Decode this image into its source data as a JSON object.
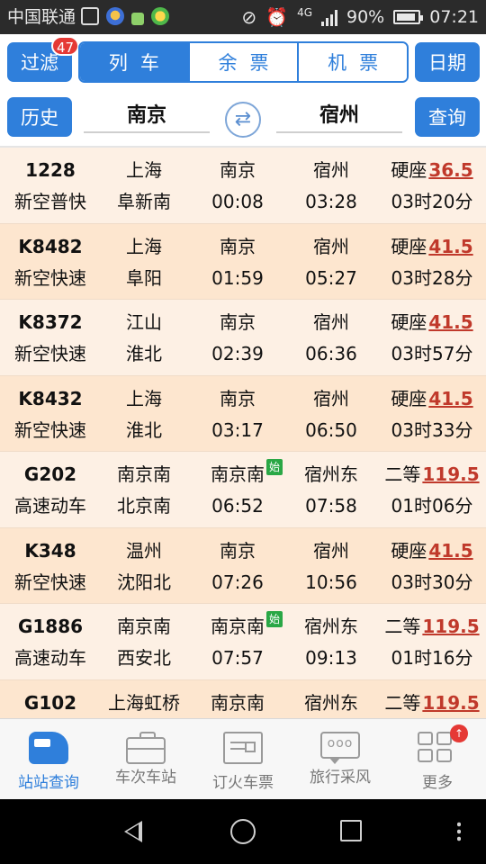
{
  "status_bar": {
    "carrier": "中国联通",
    "network": "4G",
    "battery_text": "90%",
    "battery_level": 0.9,
    "time": "07:21"
  },
  "top_bar": {
    "filter_label": "过滤",
    "filter_badge": "47",
    "segments": [
      {
        "label": "列车",
        "active": true
      },
      {
        "label": "余票",
        "active": false
      },
      {
        "label": "机票",
        "active": false
      }
    ],
    "date_label": "日期"
  },
  "search": {
    "history_label": "历史",
    "from_station": "南京",
    "to_station": "宿州",
    "swap_icon": "swap-arrows-icon",
    "query_label": "查询"
  },
  "trains": [
    {
      "no": "1228",
      "type": "新空普快",
      "origin": "上海",
      "terminal": "阜新南",
      "from": "南京",
      "depart": "00:08",
      "to": "宿州",
      "arrive": "03:28",
      "seat": "硬座",
      "price": "36.5",
      "duration": "03时20分",
      "origin_tag": ""
    },
    {
      "no": "K8482",
      "type": "新空快速",
      "origin": "上海",
      "terminal": "阜阳",
      "from": "南京",
      "depart": "01:59",
      "to": "宿州",
      "arrive": "05:27",
      "seat": "硬座",
      "price": "41.5",
      "duration": "03时28分",
      "origin_tag": ""
    },
    {
      "no": "K8372",
      "type": "新空快速",
      "origin": "江山",
      "terminal": "淮北",
      "from": "南京",
      "depart": "02:39",
      "to": "宿州",
      "arrive": "06:36",
      "seat": "硬座",
      "price": "41.5",
      "duration": "03时57分",
      "origin_tag": ""
    },
    {
      "no": "K8432",
      "type": "新空快速",
      "origin": "上海",
      "terminal": "淮北",
      "from": "南京",
      "depart": "03:17",
      "to": "宿州",
      "arrive": "06:50",
      "seat": "硬座",
      "price": "41.5",
      "duration": "03时33分",
      "origin_tag": ""
    },
    {
      "no": "G202",
      "type": "高速动车",
      "origin": "南京南",
      "terminal": "北京南",
      "from": "南京南",
      "depart": "06:52",
      "to": "宿州东",
      "arrive": "07:58",
      "seat": "二等",
      "price": "119.5",
      "duration": "01时06分",
      "origin_tag": "始"
    },
    {
      "no": "K348",
      "type": "新空快速",
      "origin": "温州",
      "terminal": "沈阳北",
      "from": "南京",
      "depart": "07:26",
      "to": "宿州",
      "arrive": "10:56",
      "seat": "硬座",
      "price": "41.5",
      "duration": "03时30分",
      "origin_tag": ""
    },
    {
      "no": "G1886",
      "type": "高速动车",
      "origin": "南京南",
      "terminal": "西安北",
      "from": "南京南",
      "depart": "07:57",
      "to": "宿州东",
      "arrive": "09:13",
      "seat": "二等",
      "price": "119.5",
      "duration": "01时16分",
      "origin_tag": "始"
    },
    {
      "no": "G102",
      "type": "",
      "origin": "上海虹桥",
      "terminal": "",
      "from": "南京南",
      "depart": "",
      "to": "宿州东",
      "arrive": "",
      "seat": "二等",
      "price": "119.5",
      "duration": "",
      "origin_tag": ""
    }
  ],
  "tabs": [
    {
      "label": "站站查询",
      "icon": "train-icon",
      "active": true
    },
    {
      "label": "车次车站",
      "icon": "briefcase-icon",
      "active": false
    },
    {
      "label": "订火车票",
      "icon": "ticket-icon",
      "active": false
    },
    {
      "label": "旅行采风",
      "icon": "chat-bubble-icon",
      "active": false
    },
    {
      "label": "更多",
      "icon": "grid-icon",
      "active": false,
      "badge_icon": "arrow-up-icon"
    }
  ],
  "colors": {
    "accent": "#2f7fdb",
    "price": "#c0392b",
    "row_light": "#fdf0e4",
    "row_dark": "#fde6cf",
    "origin_tag": "#2aa745"
  }
}
